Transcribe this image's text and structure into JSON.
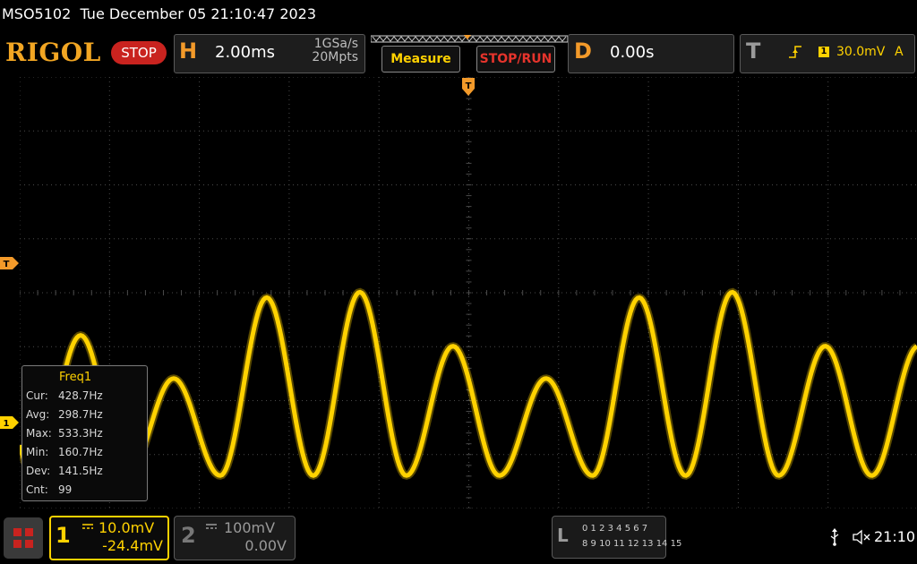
{
  "title_bar": {
    "model": "MSO5102",
    "datetime": "Tue December 05 21:10:47 2023"
  },
  "toolbar": {
    "logo": "RIGOL",
    "run_state": "STOP",
    "horizontal": {
      "letter": "H",
      "timebase": "2.00ms",
      "sample_rate": "1GSa/s",
      "memory_depth": "20Mpts"
    },
    "measure_label": "Measure",
    "stop_run_label": "STOP/RUN",
    "delay": {
      "letter": "D",
      "value": "0.00s"
    },
    "trigger": {
      "letter": "T",
      "edge_icon": "rising-edge-icon",
      "source": "1",
      "level": "30.0mV",
      "mode": "A"
    }
  },
  "markers": {
    "trigger_position": "T",
    "trigger_level": "T",
    "ch1_ground": "1"
  },
  "measurement": {
    "title": "Freq1",
    "rows": [
      {
        "label": "Cur:",
        "value": "428.7Hz"
      },
      {
        "label": "Avg:",
        "value": "298.7Hz"
      },
      {
        "label": "Max:",
        "value": "533.3Hz"
      },
      {
        "label": "Min:",
        "value": "160.7Hz"
      },
      {
        "label": "Dev:",
        "value": "141.5Hz"
      },
      {
        "label": "Cnt:",
        "value": "99"
      }
    ]
  },
  "channels": {
    "ch1": {
      "number": "1",
      "scale": "10.0mV",
      "offset": "-24.4mV",
      "color": "#ffd200"
    },
    "ch2": {
      "number": "2",
      "scale": "100mV",
      "offset": "0.00V",
      "color": "#9a9a9a"
    }
  },
  "logic": {
    "letter": "L",
    "row1": "0 1 2 3  4 5 6 7",
    "row2": "8 9 10 11 12 13 14 15"
  },
  "status": {
    "clock": "21:10"
  },
  "waveform": {
    "ch1_peaks_mV": [
      16,
      8,
      23,
      24,
      14,
      8,
      23,
      24,
      14
    ],
    "ch1_trough_mV": -10
  },
  "colors": {
    "accent_orange": "#f39a2a",
    "trace_yellow": "#ffd200",
    "stop_red": "#c9231f"
  }
}
